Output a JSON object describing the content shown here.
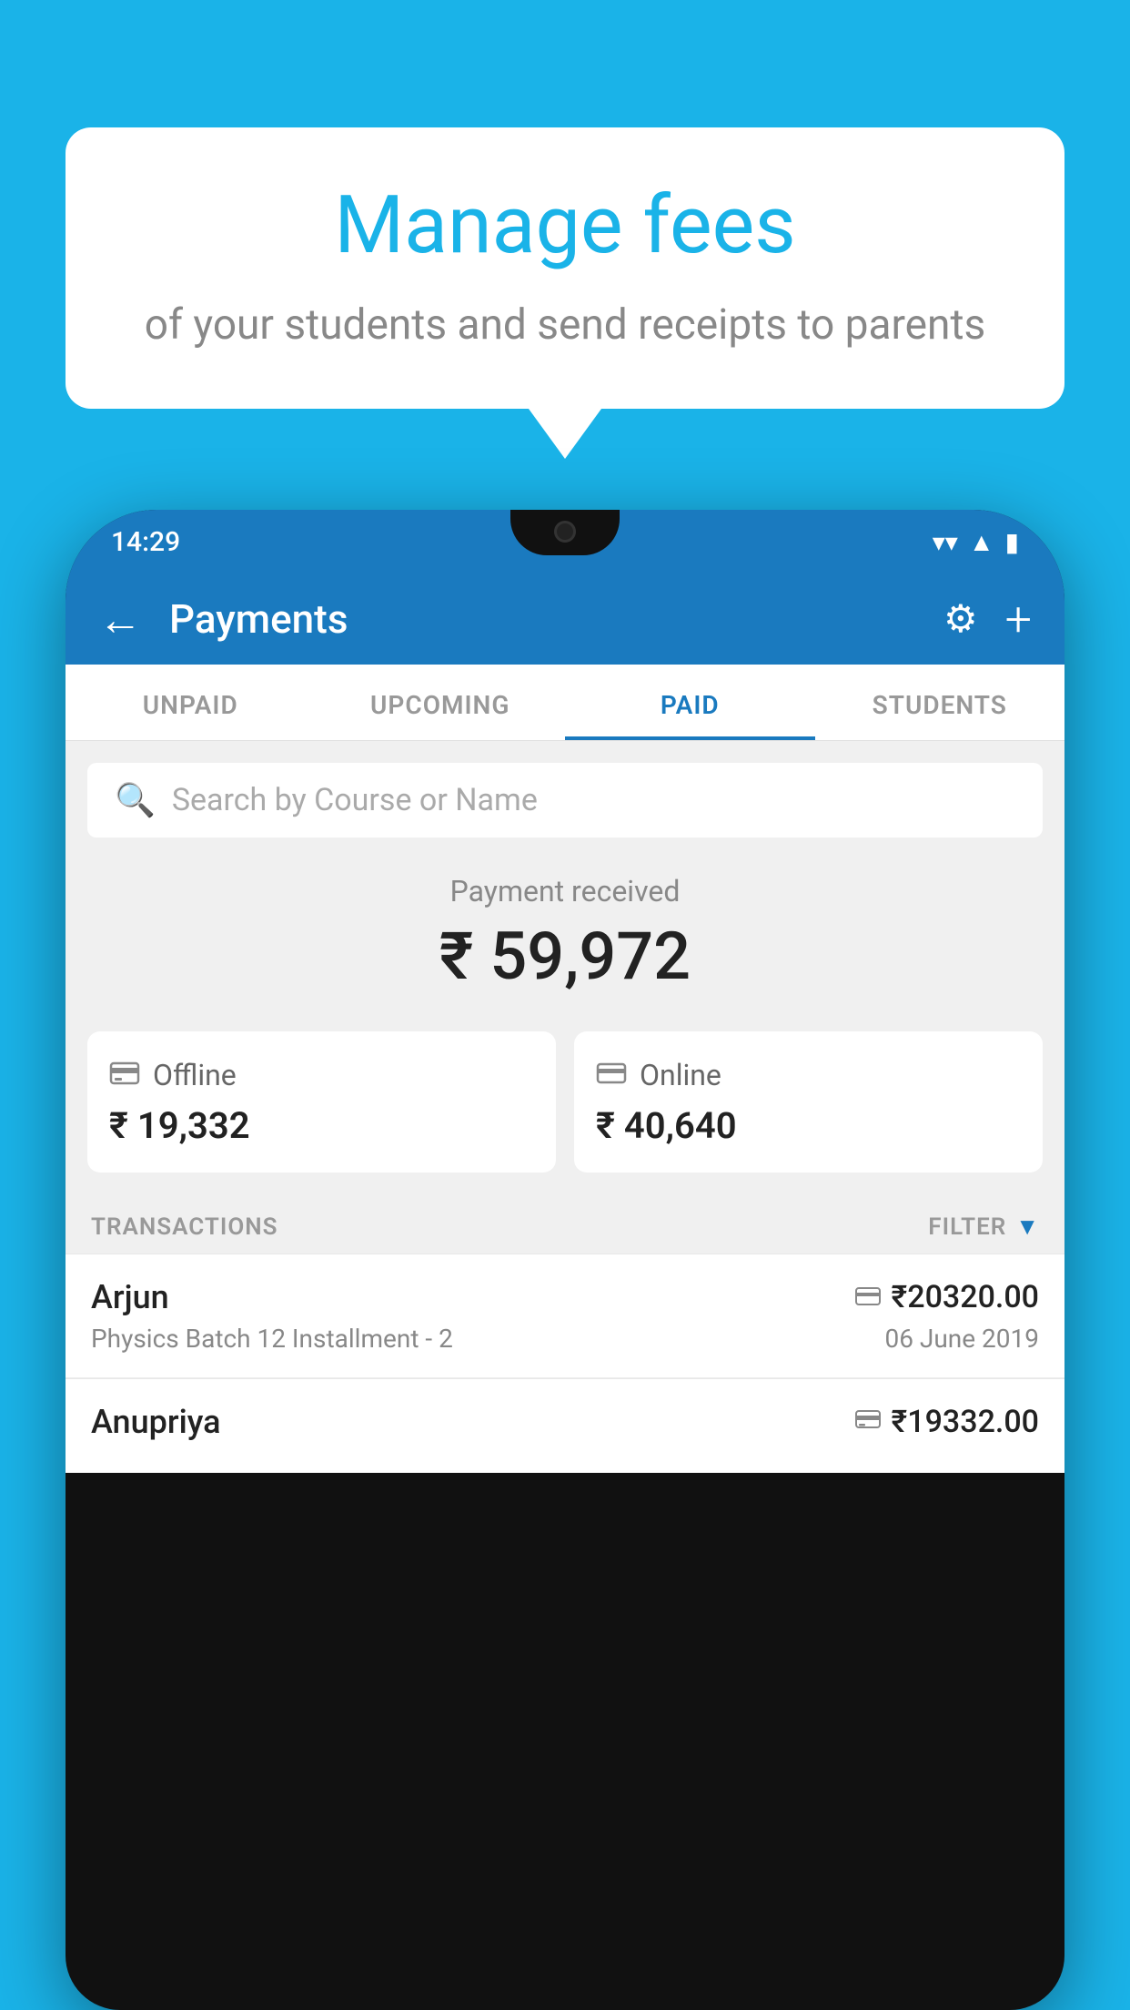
{
  "background_color": "#1ab3e8",
  "speech_bubble": {
    "title": "Manage fees",
    "subtitle": "of your students and send receipts to parents"
  },
  "status_bar": {
    "time": "14:29",
    "wifi": "▲",
    "signal": "▲",
    "battery": "▮"
  },
  "app_bar": {
    "title": "Payments",
    "back_label": "←",
    "plus_label": "+"
  },
  "tabs": [
    {
      "label": "UNPAID",
      "active": false
    },
    {
      "label": "UPCOMING",
      "active": false
    },
    {
      "label": "PAID",
      "active": true
    },
    {
      "label": "STUDENTS",
      "active": false
    }
  ],
  "search": {
    "placeholder": "Search by Course or Name"
  },
  "payment_received": {
    "label": "Payment received",
    "amount": "₹ 59,972"
  },
  "payment_cards": [
    {
      "icon": "₹",
      "label": "Offline",
      "amount": "₹ 19,332"
    },
    {
      "icon": "▬",
      "label": "Online",
      "amount": "₹ 40,640"
    }
  ],
  "transactions_section": {
    "label": "TRANSACTIONS",
    "filter_label": "FILTER"
  },
  "transactions": [
    {
      "name": "Arjun",
      "course": "Physics Batch 12 Installment - 2",
      "amount": "₹20320.00",
      "date": "06 June 2019",
      "payment_type": "online"
    },
    {
      "name": "Anupriya",
      "course": "",
      "amount": "₹19332.00",
      "date": "",
      "payment_type": "offline"
    }
  ]
}
